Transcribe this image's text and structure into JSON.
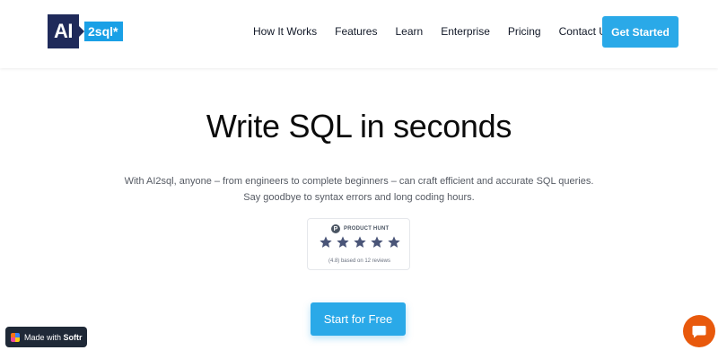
{
  "header": {
    "logo": {
      "ai_text": "AI",
      "sql_text": "2sql*"
    },
    "nav": [
      {
        "label": "How It Works"
      },
      {
        "label": "Features"
      },
      {
        "label": "Learn"
      },
      {
        "label": "Enterprise"
      },
      {
        "label": "Pricing"
      },
      {
        "label": "Contact Us"
      }
    ],
    "cta_label": "Get Started"
  },
  "hero": {
    "title": "Write SQL in seconds",
    "subtitle_line1": "With AI2sql, anyone – from engineers to complete beginners – can craft efficient and accurate SQL queries.",
    "subtitle_line2": "Say goodbye to syntax errors and long coding hours.",
    "cta_label": "Start for Free"
  },
  "product_hunt": {
    "logo_letter": "P",
    "label": "PRODUCT HUNT",
    "stars": 5,
    "caption": "(4.8) based on 12 reviews"
  },
  "softr_badge": {
    "prefix": "Made with ",
    "brand": "Softr"
  },
  "colors": {
    "accent": "#2aa9e8",
    "logo_dark": "#1f2a5a",
    "logo_blue": "#1aa0e6",
    "star": "#4a5578",
    "chat": "#e8590c"
  },
  "icons": {
    "chat": "chat-bubble-icon",
    "star": "star-icon",
    "product_hunt": "product-hunt-icon",
    "softr": "softr-logo-icon"
  }
}
